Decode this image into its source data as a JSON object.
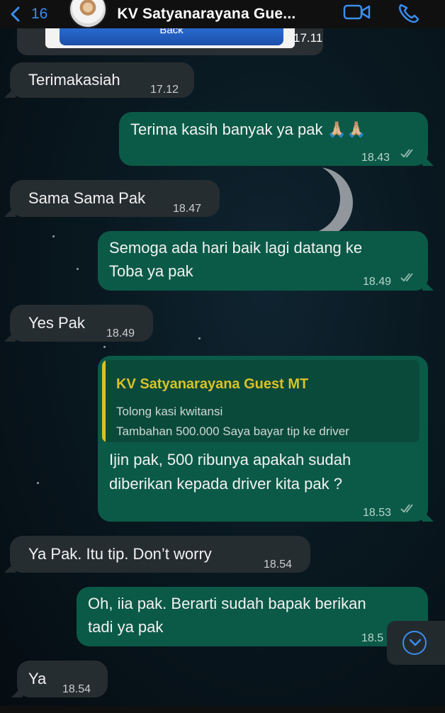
{
  "header": {
    "back_count": "16",
    "title": "KV Satyanarayana Gue..."
  },
  "image_message": {
    "button_label": "Back",
    "time": "17.11"
  },
  "messages": [
    {
      "dir": "in",
      "text": "Terimakasiah",
      "time": "17.12"
    },
    {
      "dir": "out",
      "text": "Terima kasih banyak ya pak 🙏🏼🙏🏼",
      "time": "18.43"
    },
    {
      "dir": "in",
      "text": "Sama Sama Pak",
      "time": "18.47"
    },
    {
      "dir": "out",
      "lines": [
        "Semoga ada hari baik lagi datang ke",
        "Toba ya pak"
      ],
      "time": "18.49"
    },
    {
      "dir": "in",
      "text": "Yes Pak",
      "time": "18.49"
    },
    {
      "dir": "out",
      "quote": {
        "name": "KV Satyanarayana Guest MT",
        "lines": [
          "Tolong kasi kwitansi",
          "Tambahan  500.000 Saya bayar tip ke driver"
        ]
      },
      "lines": [
        "Ijin pak, 500 ribunya apakah sudah",
        "diberikan kepada driver kita pak ?"
      ],
      "time": "18.53"
    },
    {
      "dir": "in",
      "text": "Ya Pak. Itu tip. Don’t worry",
      "time": "18.54"
    },
    {
      "dir": "out",
      "lines": [
        "Oh, iia pak. Berarti sudah bapak berikan",
        "tadi ya pak"
      ],
      "time": "18.5"
    },
    {
      "dir": "in",
      "text": "Ya",
      "time": "18.54"
    }
  ],
  "colors": {
    "incoming_bubble": "#262d31",
    "outgoing_bubble": "#0b5a47",
    "accent_blue": "#3b8ef0",
    "quote_name": "#d8c227"
  }
}
